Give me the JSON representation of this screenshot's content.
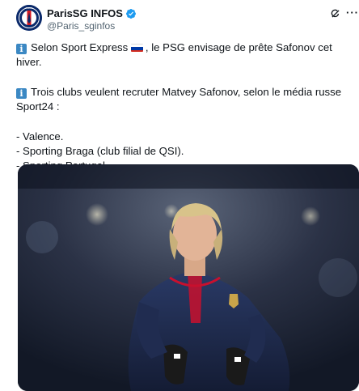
{
  "account": {
    "display_name": "ParisSG INFOS",
    "handle": "@Paris_sginfos",
    "verified": true,
    "avatar_icon": "psg-crest-icon"
  },
  "header_icons": {
    "grok": "grok-icon",
    "more": "more-icon",
    "more_glyph": "···"
  },
  "tweet": {
    "line1_after_info": "Selon Sport Express",
    "line1_after_flag": ", le PSG envisage de prête Safonov cet hiver.",
    "line2_after_info": "Trois clubs veulent recruter Matvey Safonov, selon le média russe Sport24 :",
    "list": [
      "- Valence.",
      "- Sporting Braga (club filial de QSI).",
      "- Sporting Portugal."
    ],
    "info_emoji": "i",
    "flag": "russia-flag-icon"
  },
  "media": {
    "description_icon": "player-photo",
    "colors": {
      "background": "#1a2030",
      "jersey": "#1f2a4a",
      "accent": "#c8102e"
    }
  },
  "colors": {
    "text": "#0f1419",
    "secondary": "#536471",
    "verified": "#1d9bf0",
    "info_blue": "#3b88c3"
  }
}
